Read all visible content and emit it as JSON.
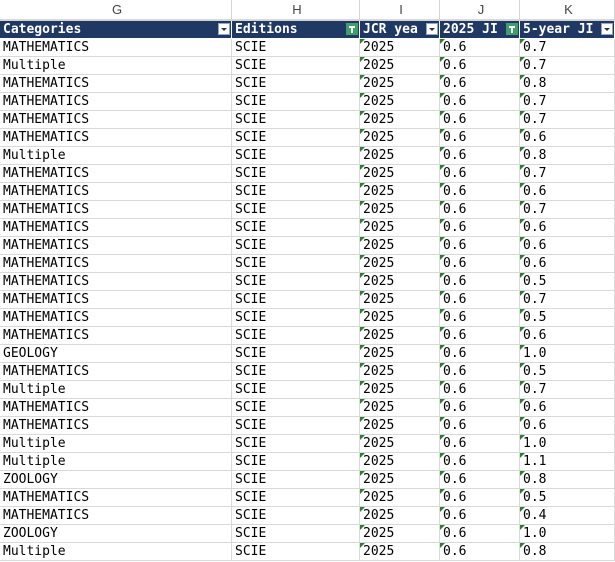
{
  "columns": [
    "G",
    "H",
    "I",
    "J",
    "K"
  ],
  "header": [
    "Categories",
    "Editions",
    "JCR yea",
    "2025 JI",
    "5-year JI"
  ],
  "rows": [
    [
      "MATHEMATICS",
      "SCIE",
      "2025",
      "0.6",
      "0.7"
    ],
    [
      "Multiple",
      "SCIE",
      "2025",
      "0.6",
      "0.7"
    ],
    [
      "MATHEMATICS",
      "SCIE",
      "2025",
      "0.6",
      "0.8"
    ],
    [
      "MATHEMATICS",
      "SCIE",
      "2025",
      "0.6",
      "0.7"
    ],
    [
      "MATHEMATICS",
      "SCIE",
      "2025",
      "0.6",
      "0.7"
    ],
    [
      "MATHEMATICS",
      "SCIE",
      "2025",
      "0.6",
      "0.6"
    ],
    [
      "Multiple",
      "SCIE",
      "2025",
      "0.6",
      "0.8"
    ],
    [
      "MATHEMATICS",
      "SCIE",
      "2025",
      "0.6",
      "0.7"
    ],
    [
      "MATHEMATICS",
      "SCIE",
      "2025",
      "0.6",
      "0.6"
    ],
    [
      "MATHEMATICS",
      "SCIE",
      "2025",
      "0.6",
      "0.7"
    ],
    [
      "MATHEMATICS",
      "SCIE",
      "2025",
      "0.6",
      "0.6"
    ],
    [
      "MATHEMATICS",
      "SCIE",
      "2025",
      "0.6",
      "0.6"
    ],
    [
      "MATHEMATICS",
      "SCIE",
      "2025",
      "0.6",
      "0.6"
    ],
    [
      "MATHEMATICS",
      "SCIE",
      "2025",
      "0.6",
      "0.5"
    ],
    [
      "MATHEMATICS",
      "SCIE",
      "2025",
      "0.6",
      "0.7"
    ],
    [
      "MATHEMATICS",
      "SCIE",
      "2025",
      "0.6",
      "0.5"
    ],
    [
      "MATHEMATICS",
      "SCIE",
      "2025",
      "0.6",
      "0.6"
    ],
    [
      "GEOLOGY",
      "SCIE",
      "2025",
      "0.6",
      "1.0"
    ],
    [
      "MATHEMATICS",
      "SCIE",
      "2025",
      "0.6",
      "0.5"
    ],
    [
      "Multiple",
      "SCIE",
      "2025",
      "0.6",
      "0.7"
    ],
    [
      "MATHEMATICS",
      "SCIE",
      "2025",
      "0.6",
      "0.6"
    ],
    [
      "MATHEMATICS",
      "SCIE",
      "2025",
      "0.6",
      "0.6"
    ],
    [
      "Multiple",
      "SCIE",
      "2025",
      "0.6",
      "1.0"
    ],
    [
      "Multiple",
      "SCIE",
      "2025",
      "0.6",
      "1.1"
    ],
    [
      "ZOOLOGY",
      "SCIE",
      "2025",
      "0.6",
      "0.8"
    ],
    [
      "MATHEMATICS",
      "SCIE",
      "2025",
      "0.6",
      "0.5"
    ],
    [
      "MATHEMATICS",
      "SCIE",
      "2025",
      "0.6",
      "0.4"
    ],
    [
      "ZOOLOGY",
      "SCIE",
      "2025",
      "0.6",
      "1.0"
    ],
    [
      "Multiple",
      "SCIE",
      "2025",
      "0.6",
      "0.8"
    ]
  ],
  "colors": {
    "header_bg": "#1f3864",
    "filter_active": "#3f9f6b",
    "number_marker": "#2e7d32"
  }
}
